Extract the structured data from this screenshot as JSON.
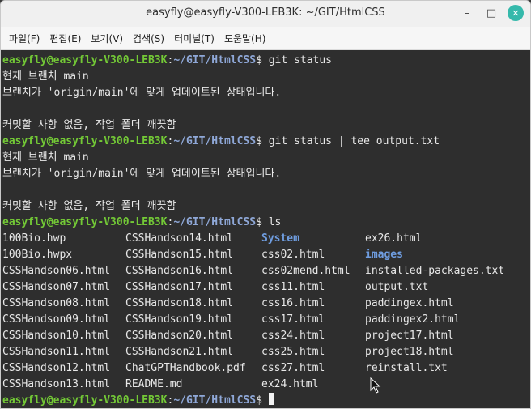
{
  "window": {
    "title": "easyfly@easyfly-V300-LEB3K: ~/GIT/HtmlCSS"
  },
  "controls": {
    "minimize": "–",
    "maximize": "□",
    "close": "✕"
  },
  "menu": [
    "파일(F)",
    "편집(E)",
    "보기(V)",
    "검색(S)",
    "터미널(T)",
    "도움말(H)"
  ],
  "prompt": {
    "user_host": "easyfly@easyfly-V300-LEB3K",
    "colon": ":",
    "path": "~/GIT/HtmlCSS",
    "dollar": "$"
  },
  "session": {
    "cmd1": " git status",
    "out1_line1": "현재 브랜치 main",
    "out1_line2": "브랜치가 'origin/main'에 맞게 업데이트된 상태입니다.",
    "out1_line3": "커밋할 사항 없음, 작업 폴더 깨끗함",
    "cmd2": " git status | tee output.txt",
    "out2_line1": "현재 브랜치 main",
    "out2_line2": "브랜치가 'origin/main'에 맞게 업데이트된 상태입니다.",
    "out2_line3": "커밋할 사항 없음, 작업 폴더 깨끗함",
    "cmd3": " ls"
  },
  "ls_rows": [
    [
      "100Bio.hwp",
      "CSSHandson14.html",
      "System",
      "ex26.html"
    ],
    [
      "100Bio.hwpx",
      "CSSHandson15.html",
      "css02.html",
      "images"
    ],
    [
      "CSSHandson06.html",
      "CSSHandson16.html",
      "css02mend.html",
      "installed-packages.txt"
    ],
    [
      "CSSHandson07.html",
      "CSSHandson17.html",
      "css11.html",
      "output.txt"
    ],
    [
      "CSSHandson08.html",
      "CSSHandson18.html",
      "css16.html",
      "paddingex.html"
    ],
    [
      "CSSHandson09.html",
      "CSSHandson19.html",
      "css17.html",
      "paddingex2.html"
    ],
    [
      "CSSHandson10.html",
      "CSSHandson20.html",
      "css24.html",
      "project17.html"
    ],
    [
      "CSSHandson11.html",
      "CSSHandson21.html",
      "css25.html",
      "project18.html"
    ],
    [
      "CSSHandson12.html",
      "ChatGPTHandbook.pdf",
      "css27.html",
      "reinstall.txt"
    ],
    [
      "CSSHandson13.html",
      "README.md",
      "ex24.html",
      ""
    ]
  ],
  "directories": [
    "System",
    "images"
  ],
  "colors": {
    "user": "#73c936",
    "path": "#8fa8d8",
    "dir": "#6f9de0",
    "bg": "#2e2e2e",
    "close": "#35b9ab"
  }
}
